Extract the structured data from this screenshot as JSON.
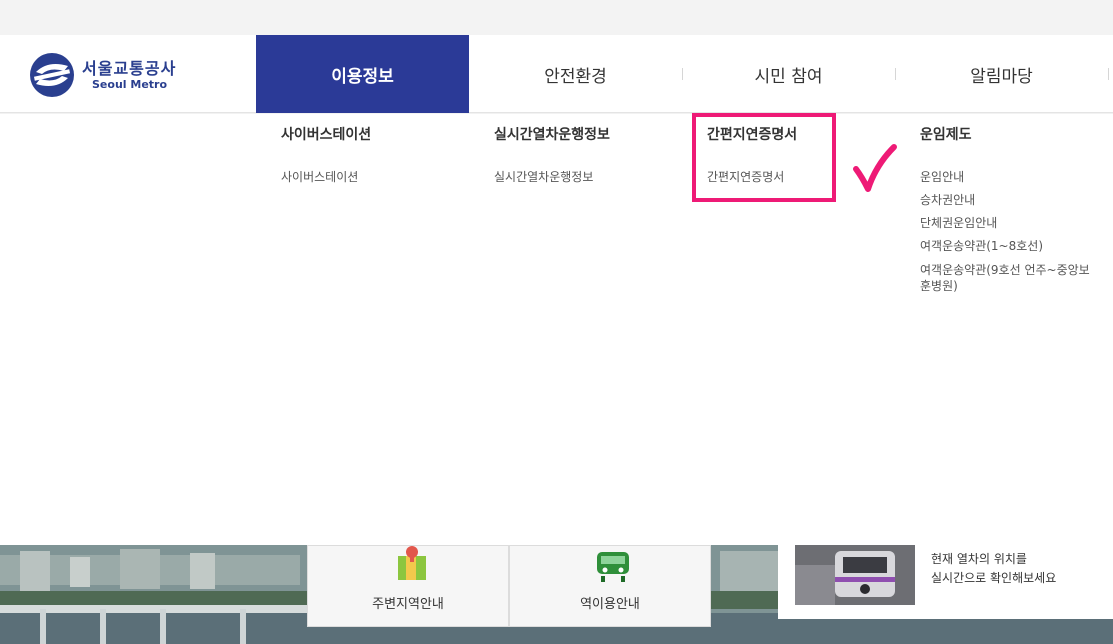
{
  "logo": {
    "korean": "서울교통공사",
    "english": "Seoul Metro"
  },
  "nav": [
    {
      "label": "이용정보",
      "active": true
    },
    {
      "label": "안전환경",
      "active": false
    },
    {
      "label": "시민 참여",
      "active": false
    },
    {
      "label": "알림마당",
      "active": false
    }
  ],
  "dropdown": {
    "columns": [
      {
        "title": "사이버스테이션",
        "links": [
          "사이버스테이션"
        ]
      },
      {
        "title": "실시간열차운행정보",
        "links": [
          "실시간열차운행정보"
        ]
      },
      {
        "title": "간편지연증명서",
        "links": [
          "간편지연증명서"
        ]
      },
      {
        "title": "운임제도",
        "links": [
          "운임안내",
          "승차권안내",
          "단체권운임안내",
          "여객운송약관(1~8호선)",
          "여객운송약관(9호선 언주~중앙보훈병원)"
        ]
      }
    ]
  },
  "annotation": {
    "box_color": "#ee1a76",
    "check_color": "#ee1a76"
  },
  "banner": {
    "cards": [
      "주변지역안내",
      "역이용안내"
    ],
    "train_info_line1": "현재 열차의 위치를",
    "train_info_line2": "실시간으로 확인해보세요"
  },
  "colors": {
    "brand": "#2b3a97",
    "highlight": "#ee1a76"
  }
}
